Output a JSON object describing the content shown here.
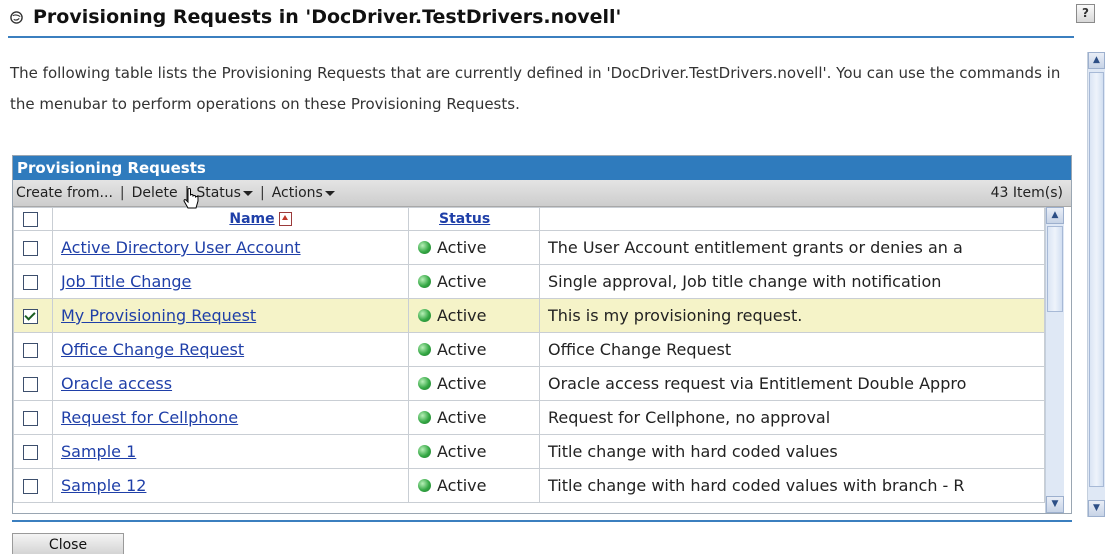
{
  "header": {
    "title": "Provisioning Requests in 'DocDriver.TestDrivers.novell'",
    "help": "?"
  },
  "description": "The following table lists the Provisioning Requests that are currently defined in 'DocDriver.TestDrivers.novell'. You can use the commands in the menubar to perform operations on these Provisioning Requests.",
  "panel": {
    "title": "Provisioning Requests",
    "menu": {
      "create": "Create from...",
      "delete": "Delete",
      "status": "Status",
      "actions": "Actions",
      "sep": "|",
      "count": "43 Item(s)"
    },
    "columns": {
      "name": "Name",
      "status": "Status"
    },
    "rows": [
      {
        "name": "Active Directory User Account",
        "status": "Active",
        "desc": "The User Account entitlement grants or denies an a",
        "checked": false
      },
      {
        "name": "Job Title Change",
        "status": "Active",
        "desc": "Single approval, Job title change with notification",
        "checked": false
      },
      {
        "name": "My Provisioning Request",
        "status": "Active",
        "desc": "This is my provisioning request.",
        "checked": true
      },
      {
        "name": "Office Change Request",
        "status": "Active",
        "desc": "Office Change Request",
        "checked": false
      },
      {
        "name": "Oracle access",
        "status": "Active",
        "desc": "Oracle access request via Entitlement Double Appro",
        "checked": false
      },
      {
        "name": "Request for Cellphone",
        "status": "Active",
        "desc": "Request for Cellphone, no approval",
        "checked": false
      },
      {
        "name": "Sample 1",
        "status": "Active",
        "desc": "Title change with hard coded values",
        "checked": false
      },
      {
        "name": "Sample 12",
        "status": "Active",
        "desc": "Title change with hard coded values with branch - R",
        "checked": false
      }
    ]
  },
  "footer": {
    "close": "Close"
  },
  "colors": {
    "accent": "#2f7bbd",
    "selected_row": "#f5f3c8",
    "link": "#1f3fa8"
  }
}
